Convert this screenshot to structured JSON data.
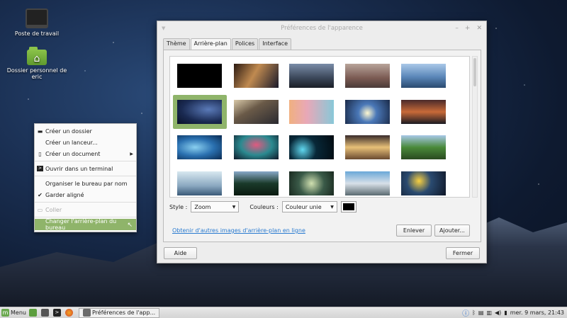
{
  "desktop": {
    "icons": [
      {
        "label": "Poste de travail",
        "icon": "computer-icon"
      },
      {
        "label": "Dossier personnel de eric",
        "icon": "home-folder-icon"
      }
    ]
  },
  "context_menu": {
    "items": [
      {
        "label": "Créer un dossier",
        "icon": "folder-icon"
      },
      {
        "label": "Créer un lanceur..."
      },
      {
        "label": "Créer un document",
        "icon": "document-icon",
        "submenu": true
      },
      {
        "label": "Ouvrir dans un terminal",
        "icon": "terminal-icon"
      },
      {
        "label": "Organiser le bureau par nom"
      },
      {
        "label": "Garder aligné",
        "checked": true
      },
      {
        "label": "Coller",
        "disabled": true,
        "icon": "paste-icon"
      },
      {
        "label": "Changer l'arrière-plan du bureau",
        "highlighted": true
      }
    ]
  },
  "window": {
    "title": "Préférences de l'apparence",
    "tabs": [
      "Thème",
      "Arrière-plan",
      "Polices",
      "Interface"
    ],
    "active_tab": "Arrière-plan",
    "style_label": "Style :",
    "style_value": "Zoom",
    "colors_label": "Couleurs :",
    "colors_value": "Couleur unie",
    "color_swatch": "#000000",
    "link": "Obtenir d'autres images d'arrière-plan en ligne",
    "remove_button": "Enlever",
    "add_button": "Ajouter...",
    "help_button": "Aide",
    "close_button": "Fermer",
    "selected_wallpaper": 5,
    "selection_color": "#8fb46a"
  },
  "taskbar": {
    "menu_label": "Menu",
    "window_label": "Préférences de l'app...",
    "clock": "mer.  9 mars, 21:43"
  }
}
